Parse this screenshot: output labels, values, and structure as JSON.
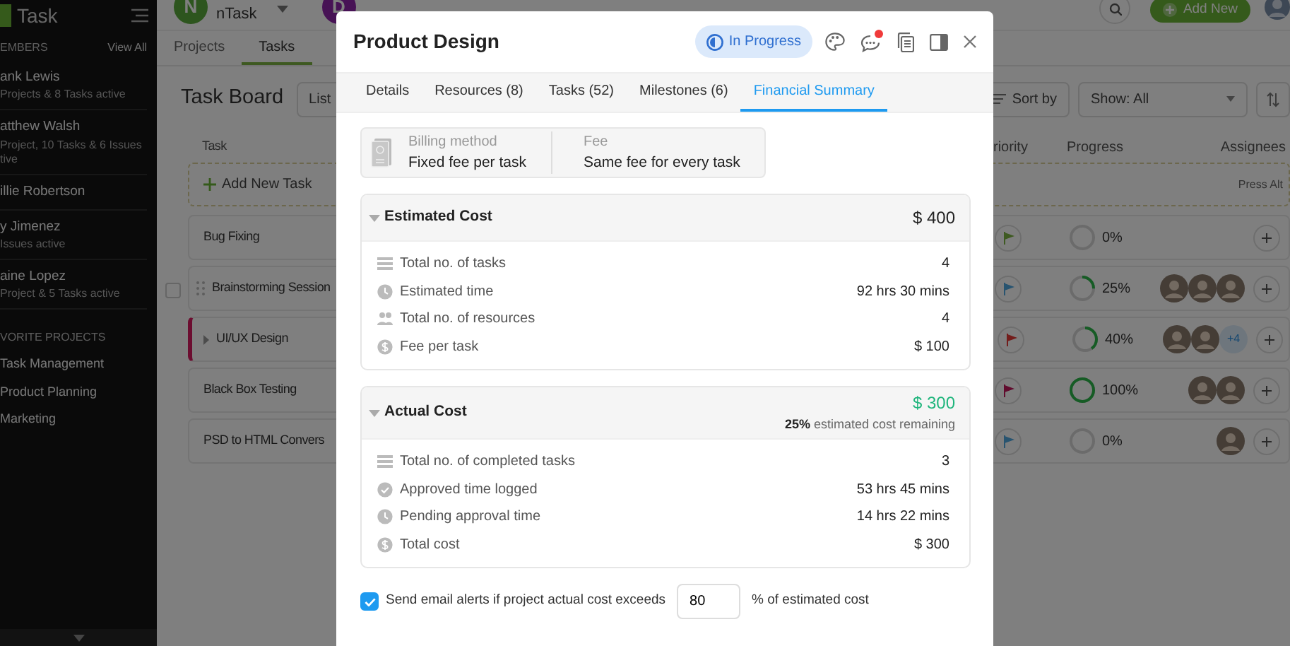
{
  "sidebar": {
    "logo": "Task",
    "members_header": "EMBERS",
    "view_all": "View All",
    "members": [
      {
        "name": "ank Lewis",
        "detail": [
          "Projects & 8 Tasks active"
        ]
      },
      {
        "name": "atthew Walsh",
        "detail": [
          "Project, 10 Tasks & 6 Issues",
          "tive"
        ]
      },
      {
        "name": "illie Robertson"
      },
      {
        "name": "y Jimenez",
        "detail": [
          "Issues active"
        ]
      },
      {
        "name": "aine Lopez",
        "detail": [
          "Project & 5 Tasks active"
        ]
      }
    ],
    "favorites_header": "VORITE PROJECTS",
    "favorites": [
      "Task Management",
      "Product Planning",
      "Marketing"
    ]
  },
  "topbar": {
    "team_initial": "N",
    "team_name": "nTask",
    "workspace_initial": "D",
    "add_new": "Add New"
  },
  "nav_tabs": [
    {
      "label": "Projects",
      "selected": false
    },
    {
      "label": "Tasks",
      "selected": true
    }
  ],
  "board": {
    "title": "Task Board",
    "view_button": "List",
    "sort_button": "Sort by",
    "show_filter": "Show: All",
    "columns": [
      "Task",
      "riority",
      "Progress",
      "Assignees"
    ],
    "add_task": "Add New Task",
    "add_hint": "Press Alt",
    "rows": [
      {
        "name": "Bug Fixing",
        "color": "#3e5a21",
        "checked": false,
        "level": 0,
        "percent": "0%",
        "assignees": [],
        "hovered": false,
        "accent": false,
        "expandable": false
      },
      {
        "name": "Brainstorming Session",
        "color": "#285470",
        "checked": false,
        "level": 0.25,
        "percent": "25%",
        "assignees": [
          {
            "kind": "avatar"
          },
          {
            "kind": "avatar"
          },
          {
            "kind": "avatar"
          }
        ],
        "hovered": true,
        "accent": false,
        "expandable": false
      },
      {
        "name": "UI/UX Design",
        "color": "#731d1b",
        "checked": false,
        "level": 0.4,
        "percent": "40%",
        "assignees": [
          {
            "kind": "avatar"
          },
          {
            "kind": "avatar"
          },
          {
            "kind": "more",
            "label": "+4"
          }
        ],
        "hovered": false,
        "accent": true,
        "expandable": true
      },
      {
        "name": "Black Box Testing",
        "color": "#610c2e",
        "checked": false,
        "level": 1,
        "percent": "100%",
        "assignees": [
          {
            "kind": "avatar"
          },
          {
            "kind": "avatar"
          }
        ],
        "hovered": false,
        "accent": false,
        "expandable": false
      },
      {
        "name": "PSD to HTML Convers",
        "color": "#285470",
        "checked": false,
        "level": 0,
        "percent": "0%",
        "assignees": [
          {
            "kind": "avatar"
          }
        ],
        "hovered": false,
        "accent": false,
        "expandable": false
      }
    ]
  },
  "modal": {
    "title": "Product Design",
    "status": "In Progress",
    "comment_unread": true,
    "tabs": [
      {
        "label": "Details",
        "selected": false
      },
      {
        "label": "Resources (8)",
        "selected": false
      },
      {
        "label": "Tasks (52)",
        "selected": false
      },
      {
        "label": "Milestones (6)",
        "selected": false
      },
      {
        "label": "Financial Summary",
        "selected": true
      }
    ],
    "billing": {
      "method_label": "Billing method",
      "method": "Fixed fee per task",
      "fee_label": "Fee",
      "fee": "Same fee for every task"
    },
    "sections": [
      {
        "title": "Estimated Cost",
        "total": "$ 400",
        "positive": false,
        "expanded": true,
        "rows": [
          {
            "kind": "list",
            "label": "Total no. of tasks",
            "value": "4"
          },
          {
            "kind": "clock",
            "label": "Estimated time",
            "value": "92 hrs 30 mins"
          },
          {
            "kind": "people",
            "label": "Total no. of resources",
            "value": "4"
          },
          {
            "kind": "dollar",
            "label": "Fee per task",
            "value": "$ 100"
          }
        ]
      },
      {
        "title": "Actual Cost",
        "total": "$ 300",
        "positive": true,
        "note": "**25%** estimated cost remaining",
        "expanded": true,
        "rows": [
          {
            "kind": "list",
            "label": "Total no. of completed tasks",
            "value": "3"
          },
          {
            "kind": "check",
            "label": "Approved time logged",
            "value": "53 hrs 45 mins"
          },
          {
            "kind": "clock",
            "label": "Pending approval time",
            "value": "14 hrs 22 mins"
          },
          {
            "kind": "dollar",
            "label": "Total cost",
            "value": "$ 300"
          }
        ]
      }
    ],
    "alert": {
      "checked": true,
      "label": "Send email alerts if project actual cost exceeds",
      "value": "80",
      "suffix": "% of estimated cost"
    }
  }
}
